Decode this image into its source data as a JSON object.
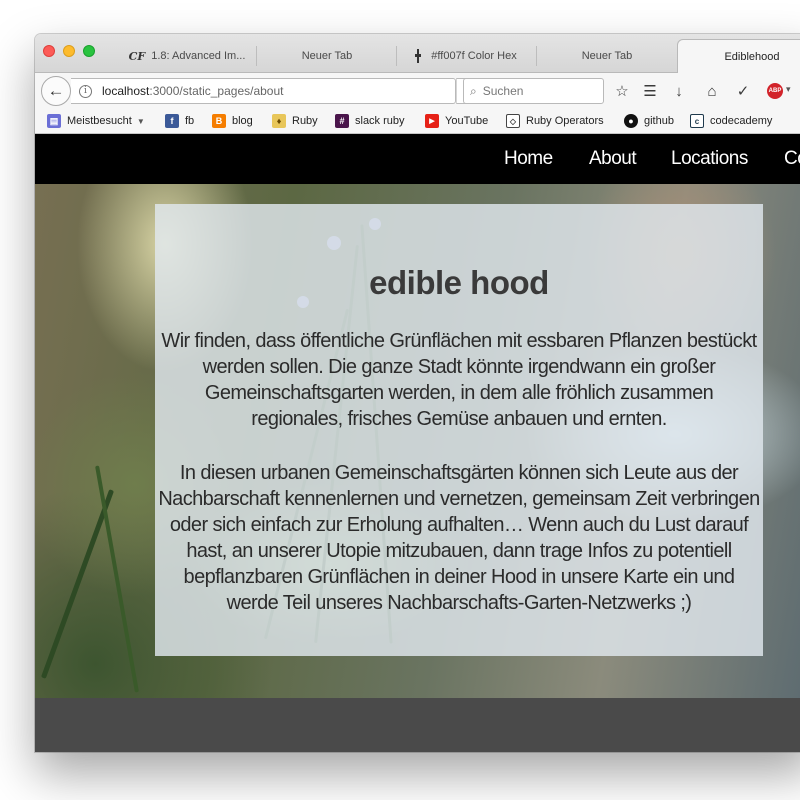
{
  "browser": {
    "tabs": [
      {
        "label": "1.8: Advanced Im...",
        "favicon": "CF"
      },
      {
        "label": "Neuer Tab"
      },
      {
        "label": "#ff007f Color Hex"
      },
      {
        "label": "Neuer Tab"
      },
      {
        "label": "Ediblehood",
        "active": true
      }
    ],
    "url": {
      "host": "localhost",
      "rest": ":3000/static_pages/about"
    },
    "search_placeholder": "Suchen",
    "toolbar_icons": [
      "star-icon",
      "reading-list-icon",
      "download-icon",
      "home-icon",
      "pocket-icon",
      "adblock-icon"
    ],
    "abp_label": "ABP",
    "bookmarks": [
      {
        "label": "Meistbesucht",
        "icon": "folder-icon",
        "color": "#6b6fd6"
      },
      {
        "label": "fb",
        "icon": "facebook-icon",
        "color": "#3b5998"
      },
      {
        "label": "blog",
        "icon": "blogger-icon",
        "color": "#f57d00"
      },
      {
        "label": "Ruby",
        "icon": "ruby-icon",
        "color": "#e8c65a"
      },
      {
        "label": "slack ruby",
        "icon": "slack-icon",
        "color": "#4a154b"
      },
      {
        "label": "YouTube",
        "icon": "youtube-icon",
        "color": "#e62117"
      },
      {
        "label": "Ruby Operators",
        "icon": "diamond-icon",
        "color": "#444444"
      },
      {
        "label": "github",
        "icon": "github-icon",
        "color": "#111111"
      },
      {
        "label": "codecademy",
        "icon": "codecademy-icon",
        "color": "#1f3a4d"
      }
    ]
  },
  "site": {
    "nav": [
      "Home",
      "About",
      "Locations",
      "Co"
    ],
    "title": "edible hood",
    "paragraph_1": "Wir finden, dass öffentliche Grünflächen mit essbaren Pflanzen bestückt werden sollen. Die ganze Stadt könnte irgendwann ein großer Gemeinschaftsgarten werden, in dem alle fröhlich zusammen regionales, frisches Gemüse anbauen und ernten.",
    "paragraph_2": "In diesen urbanen Gemeinschaftsgärten können sich Leute aus der Nachbarschaft kennenlernen und vernetzen, gemeinsam Zeit verbringen oder sich einfach zur Erholung aufhalten… Wenn auch du Lust darauf hast, an unserer Utopie mitzubauen, dann trage Infos zu potentiell bepflanzbaren Grünflächen in deiner Hood in unsere Karte ein und werde Teil unseres Nachbarschafts-Garten-Netzwerks ;)"
  },
  "colors": {
    "nav_background": "#000000",
    "card_background": "#e1e8ee",
    "footer_background": "#4a4a4a"
  }
}
